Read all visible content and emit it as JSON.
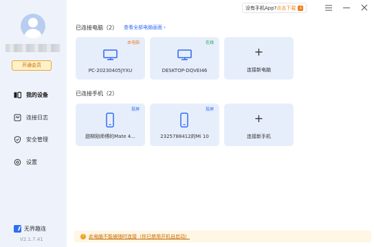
{
  "user": {
    "vip_label": "开通会员"
  },
  "sidebar": {
    "items": [
      {
        "label": "我的设备",
        "icon": "devices-icon"
      },
      {
        "label": "连接日志",
        "icon": "log-icon"
      },
      {
        "label": "安全管理",
        "icon": "shield-icon"
      },
      {
        "label": "设置",
        "icon": "gear-icon"
      }
    ],
    "brand": "无界趣连",
    "version": "V2.1.7.41"
  },
  "topbar": {
    "promo_question": "没有手机App?",
    "promo_download": "点击下载"
  },
  "pcs": {
    "title": "已连接电脑（2）",
    "view_all": "查看全部电脑画面 ›",
    "cards": [
      {
        "name": "PC-20230405JYXU",
        "tag": "本电脑",
        "tag_color": "#f0801f",
        "icon": "monitor-icon"
      },
      {
        "name": "DESKTOP-DQVEI46",
        "tag": "在线",
        "tag_color": "#1aa34a",
        "icon": "monitor-icon"
      }
    ],
    "add_label": "连接新电脑"
  },
  "phones": {
    "title": "已连接手机（2）",
    "cards": [
      {
        "name": "甜柳刚师傅的Mate 4...",
        "tag": "投屏",
        "tag_color": "#2f6cf6",
        "icon": "phone-icon"
      },
      {
        "name": "2325788412的Mi 10",
        "tag": "投屏",
        "tag_color": "#2f6cf6",
        "icon": "phone-icon"
      }
    ],
    "add_label": "连接新手机"
  },
  "notice": {
    "text": "此电脑不能被随时连接（你已禁用开机自启动）"
  },
  "colors": {
    "accent": "#2f6cf6",
    "sidebar_bg": "#eef3fb",
    "card_bg": "#e7eefb"
  }
}
